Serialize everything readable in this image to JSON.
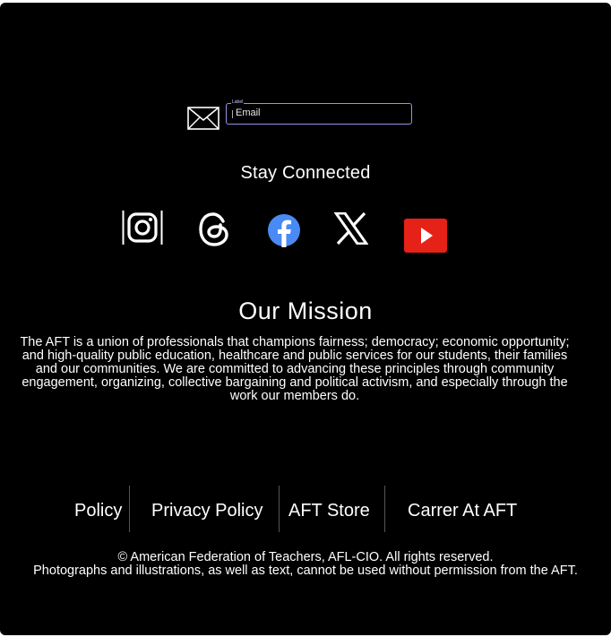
{
  "newsletter": {
    "field_label": "Label",
    "email_placeholder": "Email"
  },
  "stay_connected": "Stay Connected",
  "social": [
    {
      "name": "Instagram",
      "icon": "instagram-icon"
    },
    {
      "name": "Threads",
      "icon": "threads-icon"
    },
    {
      "name": "Facebook",
      "icon": "facebook-icon"
    },
    {
      "name": "X",
      "icon": "x-icon"
    },
    {
      "name": "YouTube",
      "icon": "youtube-icon"
    }
  ],
  "mission": {
    "title": "Our Mission",
    "text": "The AFT is a union of professionals that champions fairness; democracy; economic opportunity; and high-quality public education, healthcare and public services for our students, their families and our communities. We are committed to advancing these principles through community engagement, organizing, collective bargaining and political activism, and especially through the work our members do."
  },
  "footer_links": [
    "Policy",
    "Privacy Policy",
    "AFT Store",
    "Carrer At AFT"
  ],
  "copyright": {
    "line1": "© American Federation of Teachers, AFL-CIO.  All rights reserved.",
    "line2": "Photographs and illustrations, as well as text, cannot be used without permission from the AFT",
    "line2_end": "."
  },
  "colors": {
    "background": "#000000",
    "text": "#ffffff",
    "input_border": "#9c90e6",
    "facebook_blue": "#4a8af4",
    "youtube_red": "#e62117"
  }
}
